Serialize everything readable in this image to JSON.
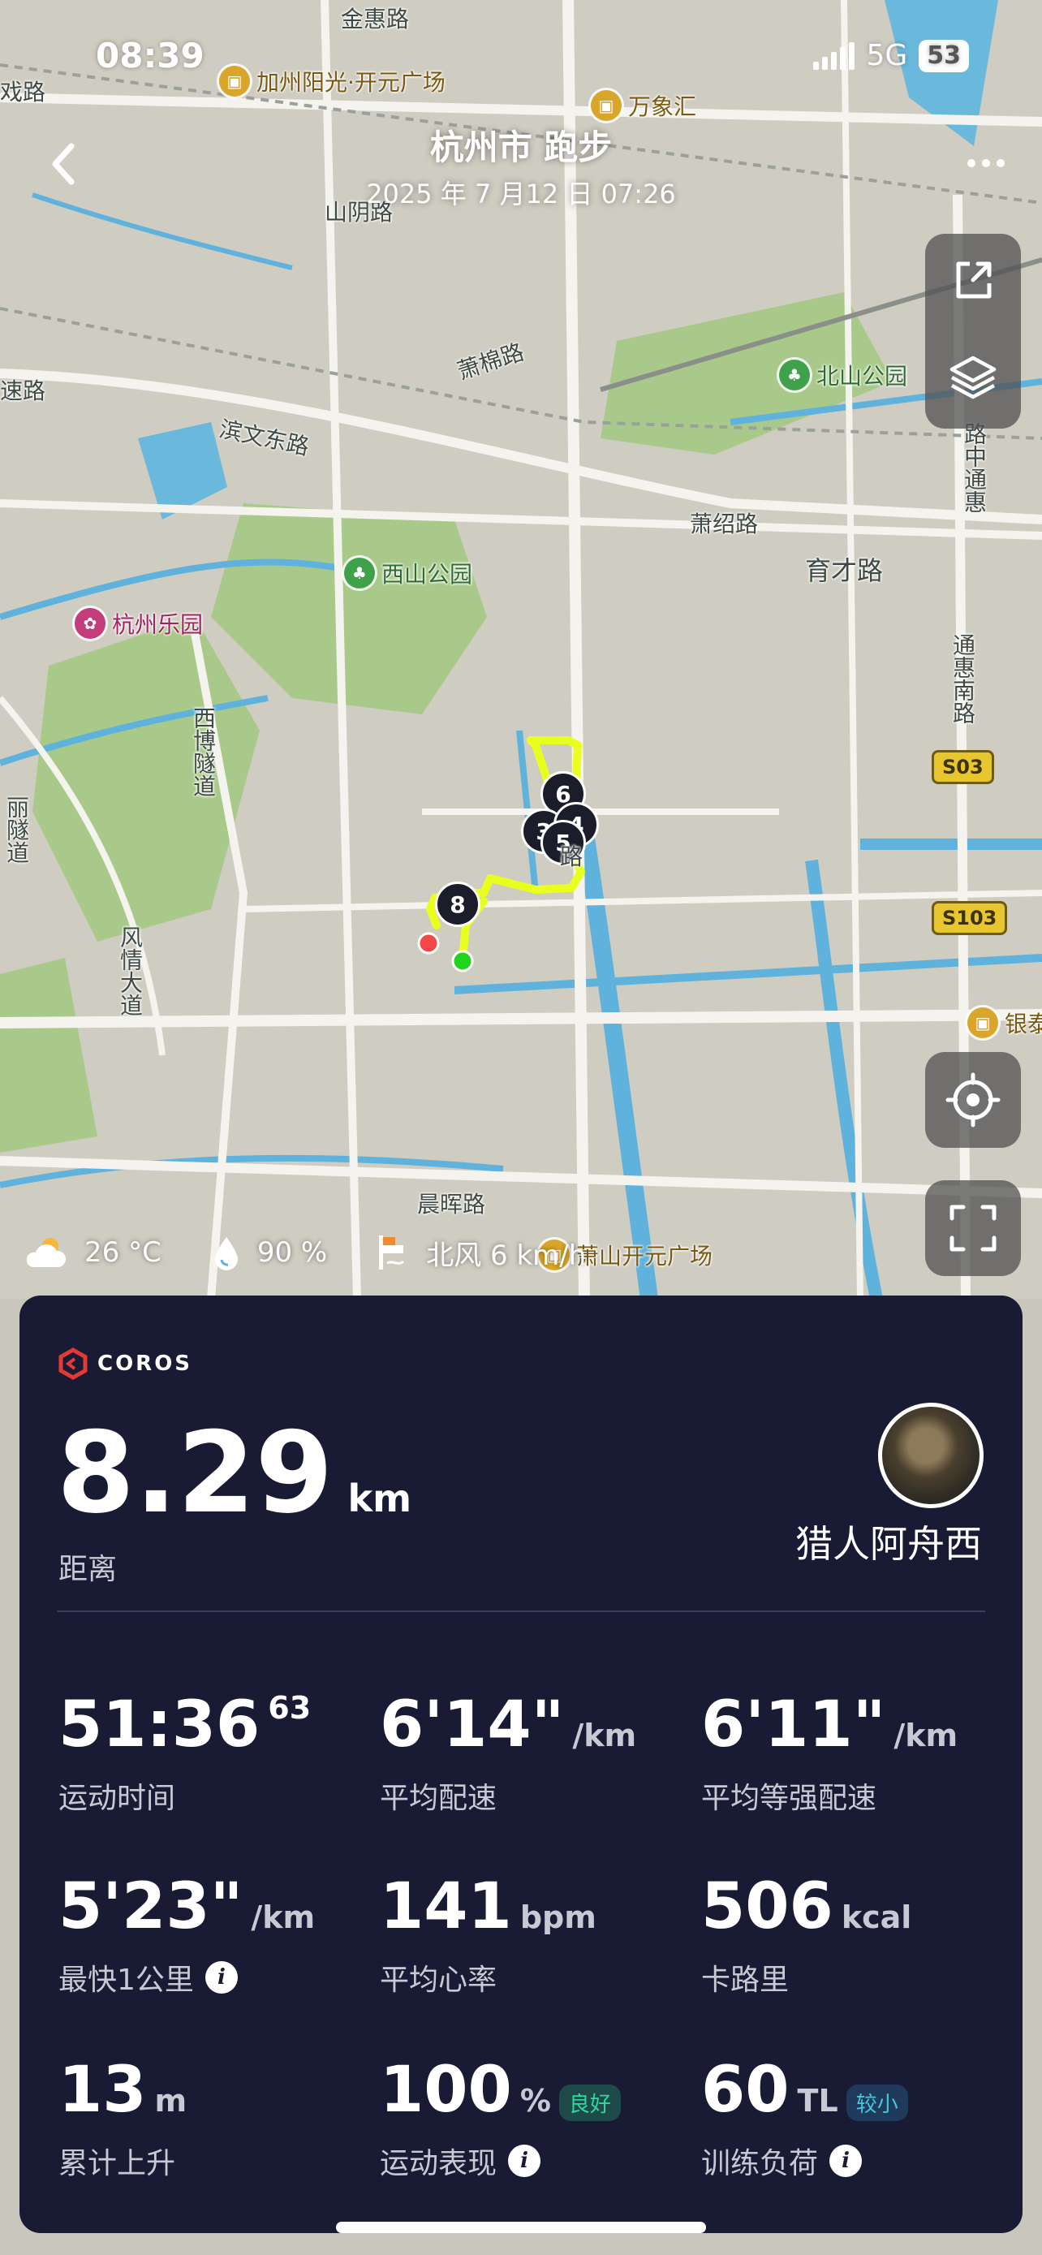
{
  "status_bar": {
    "time": "08:39",
    "network": "5G",
    "battery": "53"
  },
  "header": {
    "title": "杭州市 跑步",
    "datetime": "2025 年 7 月12 日 07:26"
  },
  "map": {
    "roads": [
      "金惠路",
      "山阴路",
      "萧棉路",
      "滨文东路",
      "萧绍路",
      "育才路",
      "西博隧道",
      "风情大道",
      "通惠南路",
      "晨晖路",
      "丽隧道",
      "路中通惠",
      "路",
      "速路",
      "戏路"
    ],
    "pois": [
      {
        "name": "加州阳光·开元广场",
        "icon": "shop-icon"
      },
      {
        "name": "万象汇",
        "icon": "shop-icon"
      },
      {
        "name": "北山公园",
        "icon": "park-icon"
      },
      {
        "name": "西山公园",
        "icon": "park-icon"
      },
      {
        "name": "杭州乐园",
        "icon": "attraction-icon"
      },
      {
        "name": "萧山开元广场",
        "icon": "shop-icon"
      },
      {
        "name": "银泰",
        "icon": "shop-icon"
      }
    ],
    "highways": [
      "S03",
      "S103"
    ],
    "markers": [
      "8",
      "3",
      "4",
      "5",
      "6"
    ],
    "route_color": "#e9ff1e",
    "start_color": "#1fd31f",
    "end_color": "#f24848"
  },
  "weather": {
    "temperature": "26 °C",
    "humidity": "90 %",
    "wind": "北风 6 km/h"
  },
  "card": {
    "brand": "COROS",
    "distance": {
      "value": "8.29",
      "unit": "km",
      "label": "距离"
    },
    "username": "猎人阿舟西",
    "metrics": [
      {
        "value": "51:36",
        "sup": "63",
        "unit": "",
        "label": "运动时间"
      },
      {
        "value": "6'14\"",
        "unit": "/km",
        "label": "平均配速"
      },
      {
        "value": "6'11\"",
        "unit": "/km",
        "label": "平均等强配速"
      },
      {
        "value": "5'23\"",
        "unit": "/km",
        "label": "最快1公里",
        "info": true
      },
      {
        "value": "141",
        "unit": "bpm",
        "label": "平均心率"
      },
      {
        "value": "506",
        "unit": "kcal",
        "label": "卡路里"
      },
      {
        "value": "13",
        "unit": "m",
        "label": "累计上升"
      },
      {
        "value": "100",
        "unit": "%",
        "badge": "良好",
        "label": "运动表现",
        "info": true
      },
      {
        "value": "60",
        "unit": "TL",
        "badge": "较小",
        "label": "训练负荷",
        "info": true
      }
    ]
  },
  "colors": {
    "card_bg": "#181b33",
    "badge_green": "#30d7a0",
    "badge_blue": "#45c7e0"
  }
}
